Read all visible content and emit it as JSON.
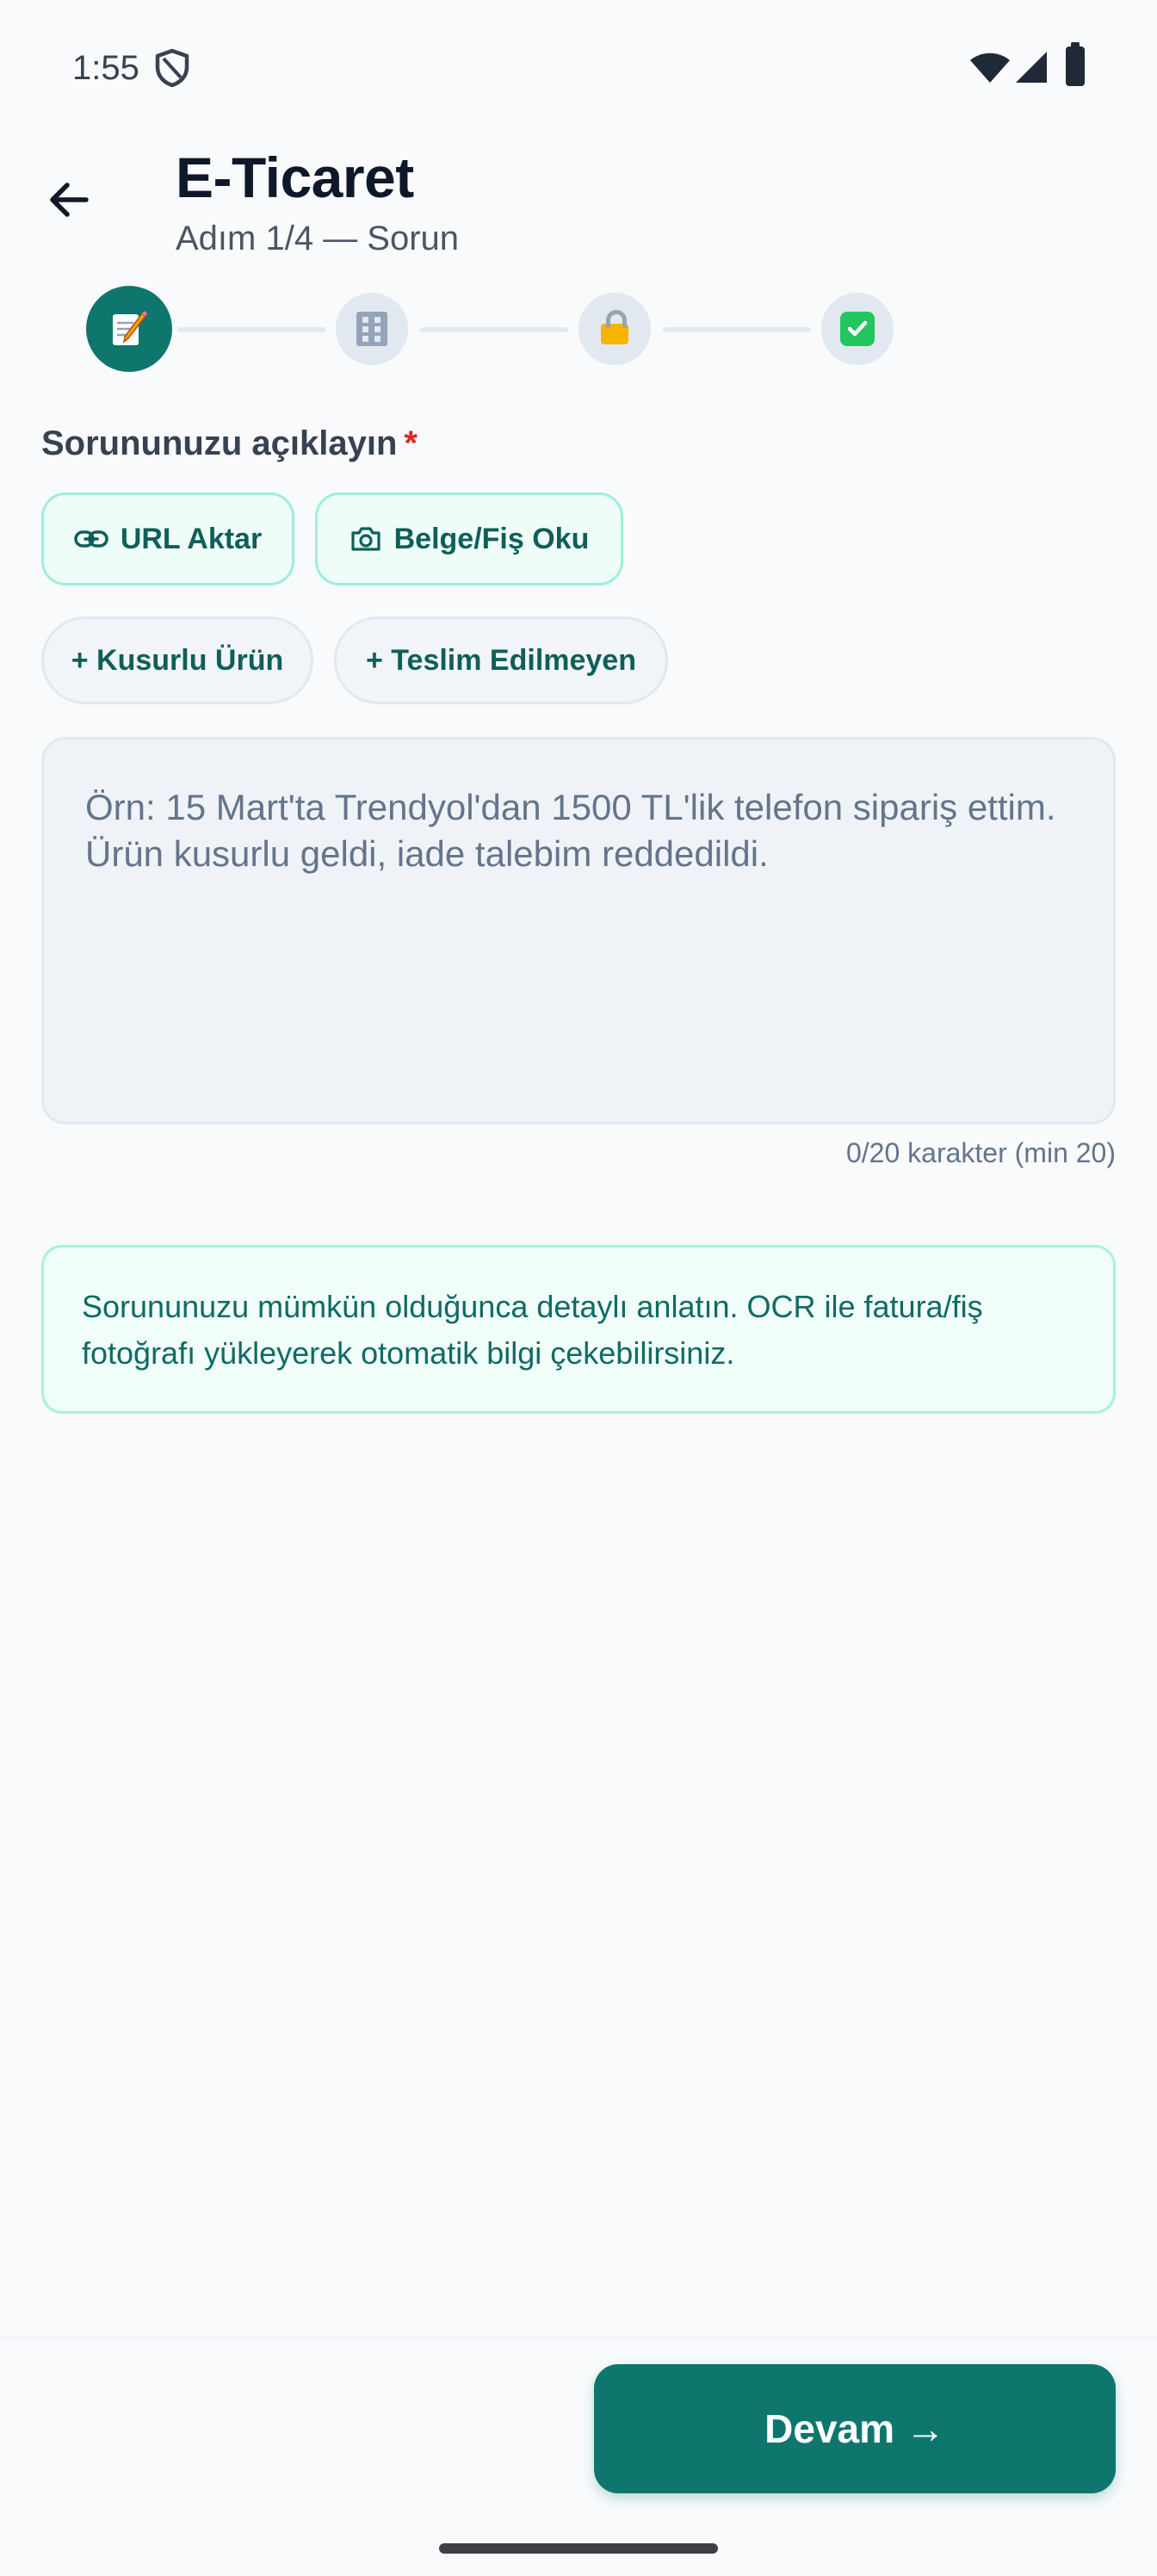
{
  "status_bar": {
    "time": "1:55"
  },
  "header": {
    "title": "E-Ticaret",
    "subtitle": "Adım 1/4 — Sorun"
  },
  "stepper": {
    "steps": [
      {
        "icon": "memo-pencil-icon",
        "active": true
      },
      {
        "icon": "office-building-icon",
        "active": false
      },
      {
        "icon": "lock-icon",
        "active": false
      },
      {
        "icon": "check-mark-button-icon",
        "active": false
      }
    ]
  },
  "form": {
    "label": "Sorununuzu açıklayın",
    "required_mark": "*",
    "quick_actions": [
      {
        "label": "URL Aktar",
        "icon": "link-icon"
      },
      {
        "label": "Belge/Fiş Oku",
        "icon": "camera-icon"
      }
    ],
    "templates": [
      {
        "label": "+ Kusurlu Ürün"
      },
      {
        "label": "+ Teslim Edilmeyen"
      }
    ],
    "textarea_placeholder": "Örn: 15 Mart'ta Trendyol'dan 1500 TL'lik telefon sipariş ettim. Ürün kusurlu geldi, iade talebim reddedildi.",
    "textarea_value": "",
    "char_counter": "0/20 karakter (min 20)"
  },
  "info_box": {
    "text": "Sorununuzu mümkün olduğunca detaylı anlatın. OCR ile fatura/fiş fotoğrafı yükleyerek otomatik bilgi çekebilirsiniz."
  },
  "footer": {
    "continue_label": "Devam →"
  },
  "colors": {
    "primary": "#0f766e",
    "chip_border": "#99f0dc",
    "background": "#f8fafc",
    "required": "#dc2626"
  }
}
